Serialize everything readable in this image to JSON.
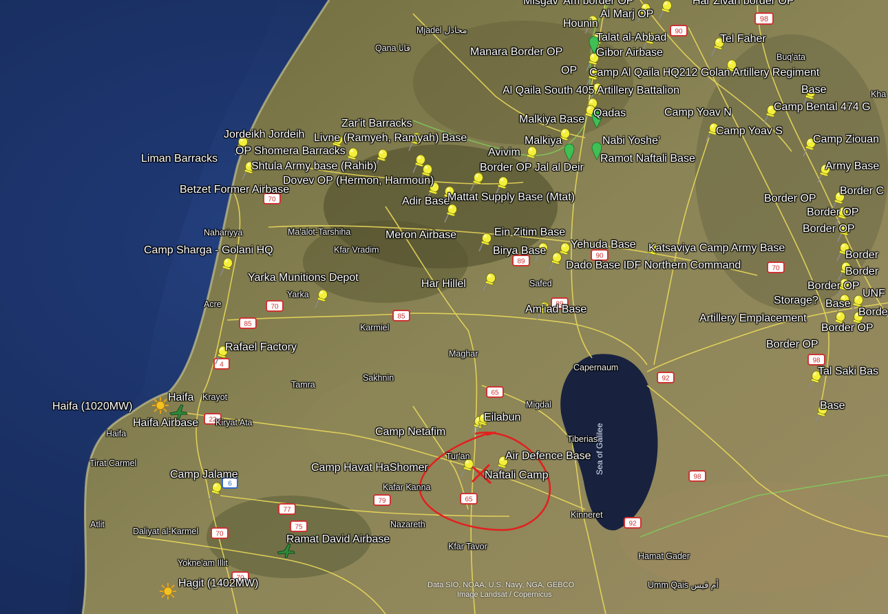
{
  "colors": {
    "sea": "#1d3470",
    "land": "#7d7a4a",
    "road": "#e9d85a",
    "pin": "#f3ef3a",
    "pin_green": "#3fbf54",
    "annotation": "#e41e1e",
    "lake": "#18223f"
  },
  "icons": {
    "pin": "pushpin-icon",
    "power_plant": "sun-icon",
    "airport": "airplane-icon",
    "route": "route-shield-icon"
  },
  "labels": {
    "misgav": "Misgav 'Am border OP",
    "al_marj": "Al Marj OP",
    "har_zivan": "Har Zivan border OP",
    "hounin": "Hounin",
    "talat": "Talat al-Abbad",
    "tel_faher": "Tel Faher",
    "majdel": "Mjadel مجادل",
    "qana": "Qana قانا",
    "manara": "Manara Border OP",
    "gibor": "Gibor Airbase",
    "buqata": "Buq'ata",
    "op": "OP",
    "camp_al_qaila": "Camp Al Qaila HQ212 Golan Artillery Regiment",
    "al_qaila_south": "Al Qaila South 405 Artillery Battalion",
    "base_ne": "Base",
    "kha": "Kha",
    "malkiya_base": "Malkiya Base",
    "qadas": "Qadas",
    "camp_yoav_n": "Camp Yoav N",
    "camp_bental": "Camp Bental 474 G",
    "camp_yoav_s": "Camp Yoav S",
    "camp_ziouan": "Camp Ziouan",
    "zarit": "Zar'it Barracks",
    "jordeikh": "Jordeikh Jordeih",
    "livne": "Livne (Ramyeh, Ramyah) Base",
    "malkiya": "Malkiya",
    "nabi": "Nabi Yoshe'",
    "avivim": "Avivim",
    "ramot": "Ramot Naftali Base",
    "op_shomera": "OP Shomera Barracks",
    "liman": "Liman Barracks",
    "shtula": "Shtula Army base (Rahib)",
    "border_op_jal": "Border OP Jal al Deir",
    "army_base": "Army Base",
    "dovev": "Dovev OP (Hermon, Harmoun)",
    "betzet": "Betzet Former Airbase",
    "adir": "Adir Base",
    "mattat": "Mattat Supply Base (Mtat)",
    "border_op_1": "Border OP",
    "border_c": "Border C",
    "border_op_2": "Border OP",
    "border_op_3": "Border OP",
    "nahariyya": "Nahariyya",
    "maalot": "Ma'alot-Tarshiha",
    "meron": "Meron Airbase",
    "ein_zitim": "Ein Zitim Base",
    "kfar_vradim": "Kfar Vradim",
    "camp_sharga": "Camp Sharga - Golani HQ",
    "birya": "Birya Base",
    "yehuda": "Yehuda Base",
    "katsaviya": "Katsaviya Camp Army Base",
    "border_r": "Border",
    "dado": "Dado Base IDF Northern Command",
    "border_r2": "Border",
    "yarka_depot": "Yarka Munitions Depot",
    "har_hillel": "Har Hillel",
    "safed": "Safed",
    "border_op_4": "Border OP",
    "yarka": "Yarka",
    "storage": "Storage?",
    "base_2": "Base",
    "unf": "UNF",
    "acre": "Acre",
    "amiad": "Am'iad Base",
    "border_r3": "Borde",
    "artillery": "Artillery Emplacement",
    "border_op_5": "Border OP",
    "karmiel": "Karmiel",
    "rafael": "Rafael Factory",
    "border_op_6": "Border OP",
    "maghar": "Maghar",
    "capernaum": "Capernaum",
    "tal_saki": "Tal Saki Bas",
    "sakhnin": "Sakhnin",
    "tamra": "Tamra",
    "krayot": "Krayot",
    "haifa_pp": "Haifa (1020MW)",
    "haifa_lbl": "Haifa",
    "haifa_airbase": "Haifa Airbase",
    "kiryat_ata": "Kiryat Ata",
    "migdal": "Migdal",
    "base_3": "Base",
    "eilabun": "Eilabun",
    "haifa_city": "Haifa",
    "camp_netafim": "Camp Netafim",
    "tiberias": "Tiberias",
    "turan": "Tur'an",
    "air_defence": "Air Defence Base",
    "sea_of_galilee": "Sea of Galilee",
    "tirat_carmel": "Tirat Carmel",
    "camp_havat": "Camp Havat HaShomer",
    "naftali": "Naftali Camp",
    "camp_jalame": "Camp Jalame",
    "kafar_kanna": "Kafar Kanna",
    "atlit": "Atlit",
    "kinneret": "Kinneret",
    "daliyat": "Daliyat al-Karmel",
    "nazareth": "Nazareth",
    "ramat_david": "Ramat David Airbase",
    "kfar_tavor": "Kfar Tavor",
    "hamat_gader": "Hamat Gader",
    "yokneam": "Yokne'am Illit",
    "hagit": "Hagit (1402MW)",
    "umm_qais": "Umm Qais أم قيس"
  },
  "routes": [
    "98",
    "90",
    "70",
    "70",
    "90",
    "89",
    "89",
    "70",
    "85",
    "85",
    "4",
    "65",
    "92",
    "22",
    "6",
    "77",
    "79",
    "65",
    "75",
    "70",
    "98",
    "92",
    "98",
    "70"
  ],
  "attribution": {
    "line1": "Data SIO, NOAA, U.S. Navy, NGA, GEBCO",
    "line2": "Image Landsat / Copernicus"
  }
}
